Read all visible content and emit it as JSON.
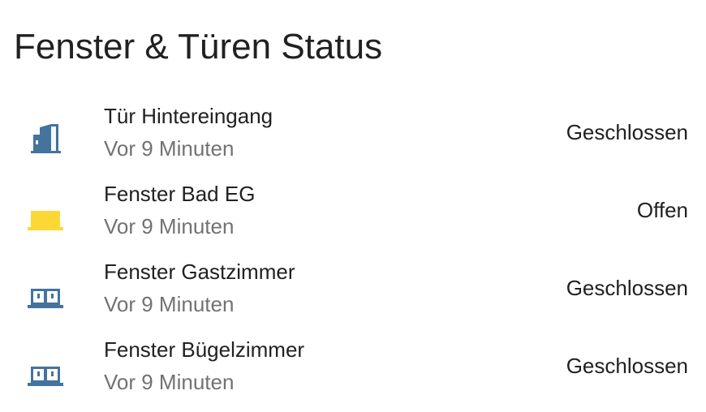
{
  "card": {
    "title": "Fenster & Türen Status"
  },
  "colors": {
    "closed_icon": "#44739e",
    "open_icon": "#fdd835",
    "primary_text": "#212121",
    "secondary_text": "#727272"
  },
  "entities": [
    {
      "name": "Tür Hintereingang",
      "last_changed": "Vor 9 Minuten",
      "state": "Geschlossen",
      "icon": "door-closed-icon"
    },
    {
      "name": "Fenster Bad EG",
      "last_changed": "Vor 9 Minuten",
      "state": "Offen",
      "icon": "window-open-icon"
    },
    {
      "name": "Fenster Gastzimmer",
      "last_changed": "Vor 9 Minuten",
      "state": "Geschlossen",
      "icon": "window-closed-icon"
    },
    {
      "name": "Fenster Bügelzimmer",
      "last_changed": "Vor 9 Minuten",
      "state": "Geschlossen",
      "icon": "window-closed-icon"
    }
  ]
}
